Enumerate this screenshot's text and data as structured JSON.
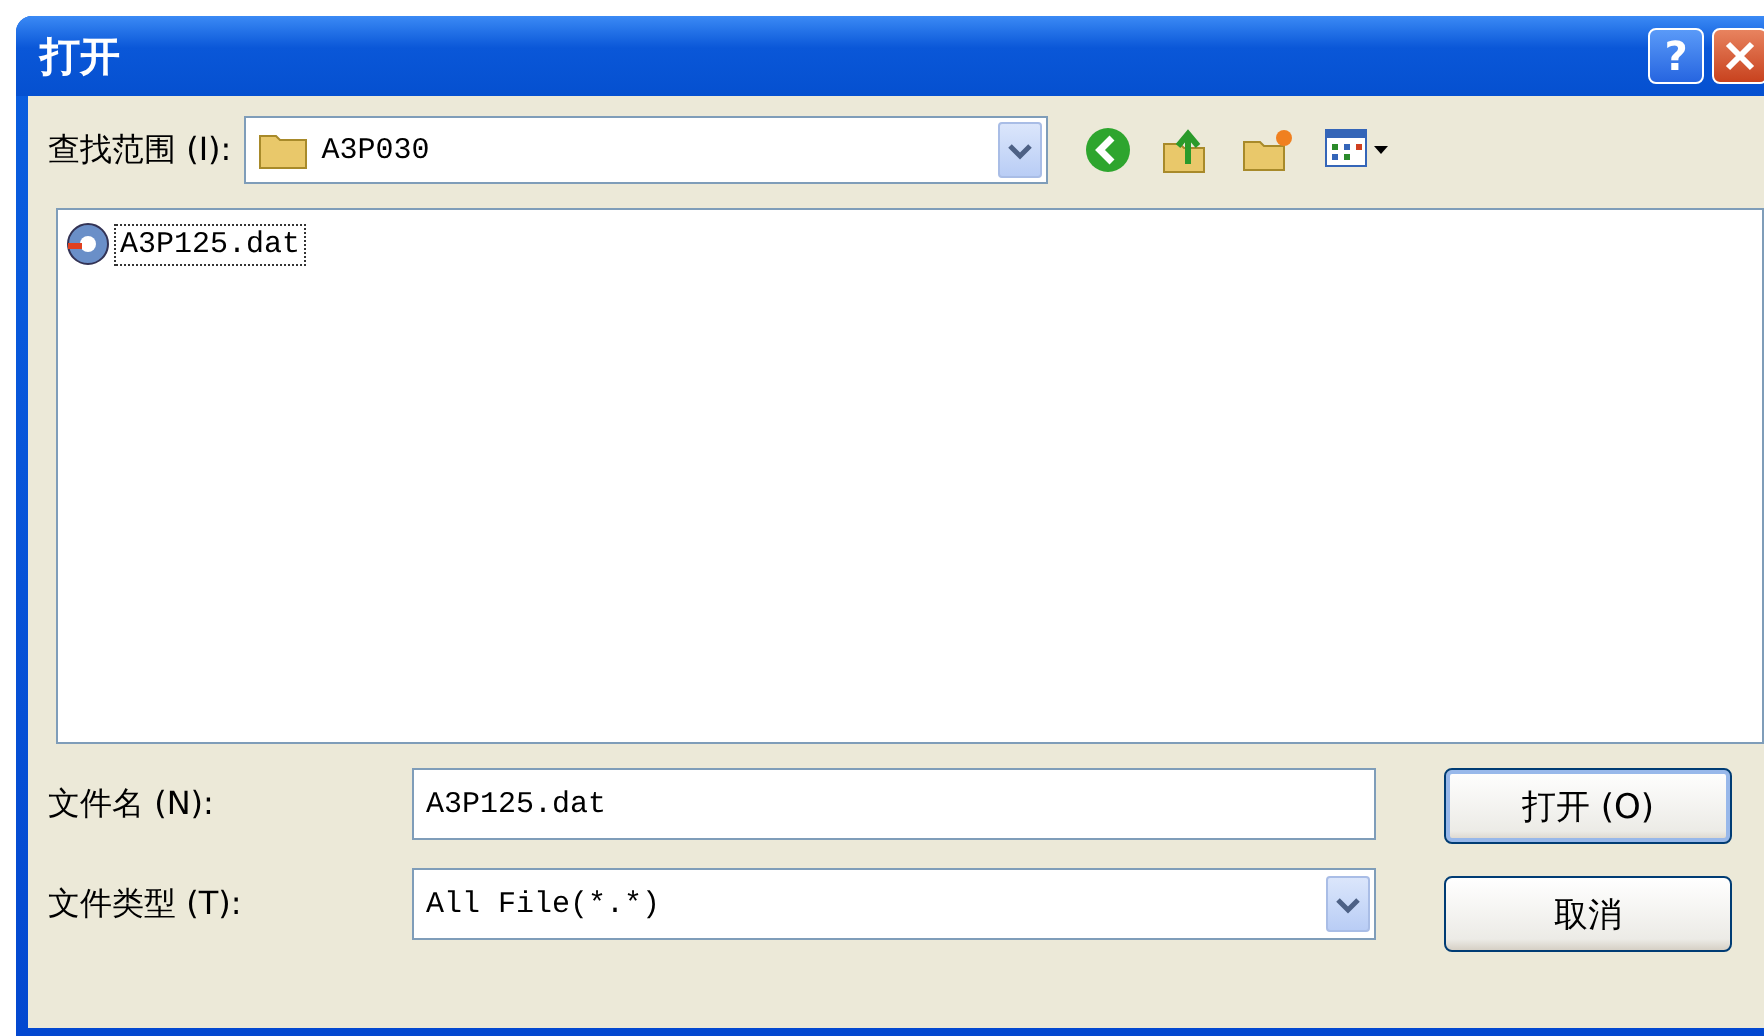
{
  "window": {
    "title": "打开",
    "help": "?"
  },
  "look_in": {
    "label": "查找范围 (I):",
    "value": "A3P030"
  },
  "files": [
    {
      "name": "A3P125.dat",
      "focused": true
    }
  ],
  "file_name": {
    "label": "文件名 (N):",
    "value": "A3P125.dat"
  },
  "file_type": {
    "label": "文件类型 (T):",
    "value": "All File(*.*)"
  },
  "buttons": [
    {
      "label": "打开 (O)",
      "default": true
    },
    {
      "label": "取消",
      "default": false
    }
  ]
}
